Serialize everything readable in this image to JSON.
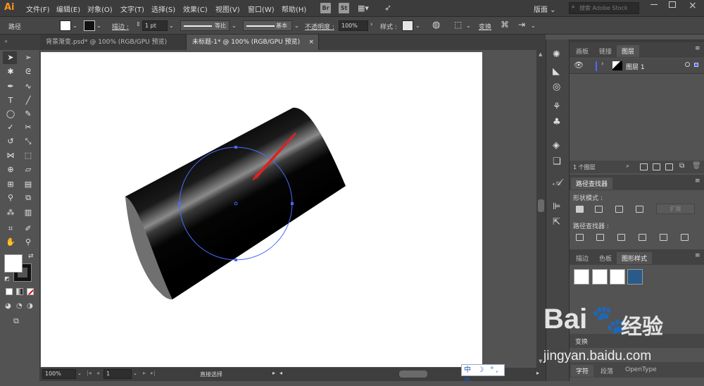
{
  "app": {
    "logo": "Ai",
    "bridge": "Br",
    "stock": "St",
    "workspace": "版面",
    "search_placeholder": "搜索 Adobe Stock"
  },
  "menu": [
    "文件(F)",
    "编辑(E)",
    "对象(O)",
    "文字(T)",
    "选择(S)",
    "效果(C)",
    "视图(V)",
    "窗口(W)",
    "帮助(H)"
  ],
  "control": {
    "selection_label": "路径",
    "stroke_label": "描边 :",
    "stroke_weight": "1 pt",
    "profile_label": "等比",
    "brush_label": "基本",
    "opacity_label": "不透明度 :",
    "opacity_value": "100%",
    "style_label": "样式 :",
    "transform_label": "变换"
  },
  "tabs": [
    {
      "label": "背景渐变.psd* @ 100% (RGB/GPU 预览)"
    },
    {
      "label": "未标题-1* @ 100% (RGB/GPU 预览)"
    }
  ],
  "tab_close": "×",
  "status": {
    "zoom": "100%",
    "page": "1",
    "tool_name": "直接选择"
  },
  "panels": {
    "layers_tabs": [
      "画板",
      "链接",
      "图层"
    ],
    "layer_name": "图层 1",
    "layer_count": "1 个图层",
    "pathfinder_title": "路径查找器",
    "shape_modes_label": "形状模式 :",
    "expand_button": "扩展",
    "pathfinders_label": "路径查找器 :",
    "styles_tabs": [
      "描边",
      "色板",
      "图形样式"
    ],
    "bottom_label": "变换",
    "char_tabs": [
      "字符",
      "段落",
      "OpenType"
    ]
  },
  "ime": "中 ☽ °, ⚙",
  "watermark": {
    "brand": "Bai",
    "brand2": "经验",
    "url": "jingyan.baidu.com"
  },
  "colors": {
    "accent": "#f7941d",
    "arrow": "#e02020",
    "selection": "#4a6cff"
  }
}
